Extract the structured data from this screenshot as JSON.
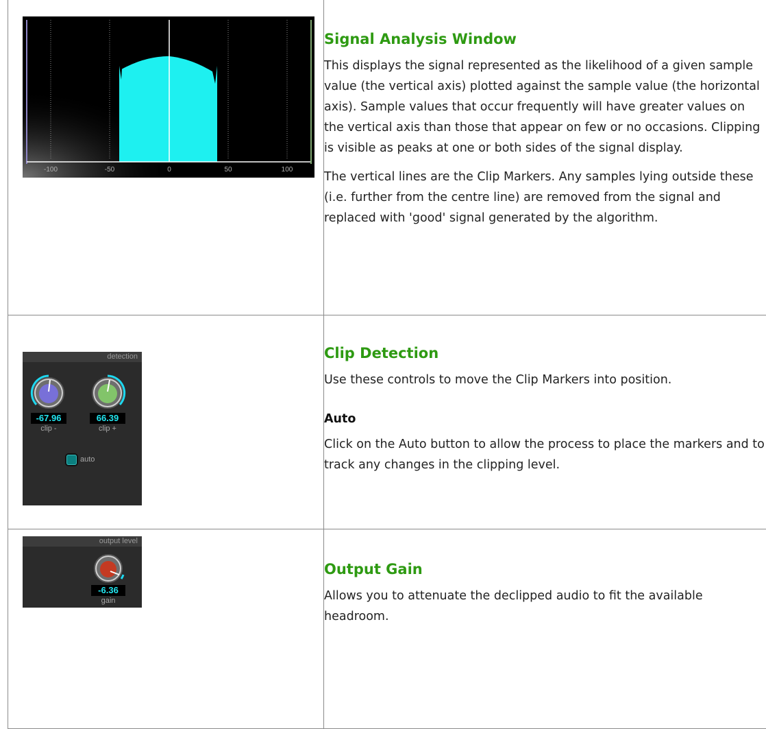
{
  "signal": {
    "heading": "Signal Analysis Window",
    "para1": "This displays the signal represented as the likelihood of a given sample value (the vertical axis) plotted against the sample value (the horizontal axis). Sample values that occur frequently will have greater values on the vertical axis than those that appear on few or no occasions. Clipping is visible as peaks at one or both sides of the signal display.",
    "para2": "The vertical lines are the Clip Markers. Any samples lying outside these (i.e. further from the centre line) are removed from the signal and replaced with 'good' signal generated by the algorithm.",
    "ticks": [
      "-100",
      "-50",
      "0",
      "50",
      "100"
    ],
    "fill_color": "#1ef0f0"
  },
  "clip": {
    "heading": "Clip Detection",
    "para": "Use these controls to move the Clip Markers into position.",
    "subheading": "Auto",
    "subpara": "Click on the Auto button to allow the process to place the markers and to track any changes in the clipping level.",
    "panel_title": "detection",
    "clip_minus": {
      "value": "-67.96",
      "label": "clip -"
    },
    "clip_plus": {
      "value": "66.39",
      "label": "clip +"
    },
    "auto_label": "auto"
  },
  "output": {
    "heading": "Output Gain",
    "para": "Allows you to attenuate the declipped audio to fit the available headroom.",
    "panel_title": "output level",
    "gain": {
      "value": "-6.36",
      "label": "gain"
    }
  }
}
